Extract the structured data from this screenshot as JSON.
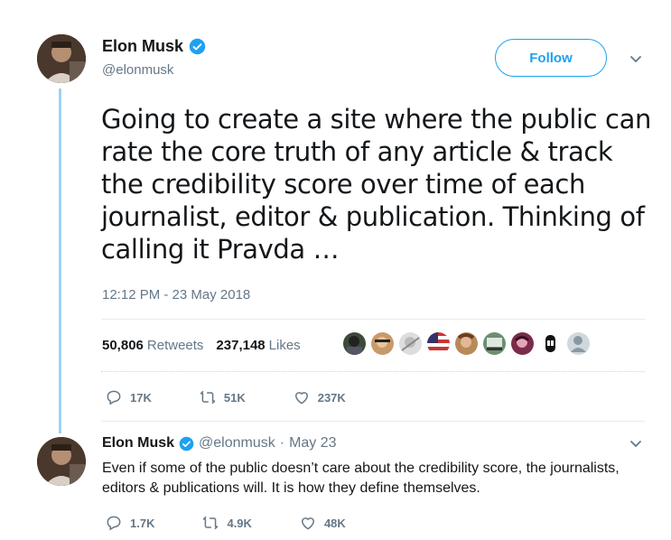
{
  "tweet": {
    "author_name": "Elon Musk",
    "author_handle": "@elonmusk",
    "follow_label": "Follow",
    "text": "Going to create a site where the public can rate the core truth of any article & track the credibility score over time of each journalist, editor & publication. Thinking of calling it Pravda …",
    "timestamp": "12:12 PM - 23 May 2018",
    "retweets_count": "50,806",
    "retweets_label": "Retweets",
    "likes_count": "237,148",
    "likes_label": "Likes",
    "reply_count": "17K",
    "retweet_count_short": "51K",
    "like_count_short": "237K"
  },
  "reply": {
    "author_name": "Elon Musk",
    "author_handle": "@elonmusk",
    "separator": "·",
    "date": "May 23",
    "text": "Even if some of the public doesn’t care about the credibility score, the journalists, editors & publications will. It is how they define themselves.",
    "reply_count": "1.7K",
    "retweet_count": "4.9K",
    "like_count": "48K"
  },
  "colors": {
    "accent": "#1da1f2",
    "thread_line": "#9fd2f1",
    "muted_text": "#657786"
  },
  "icons": [
    "verified-badge-icon",
    "chevron-down-icon",
    "reply-icon",
    "retweet-icon",
    "like-icon"
  ]
}
